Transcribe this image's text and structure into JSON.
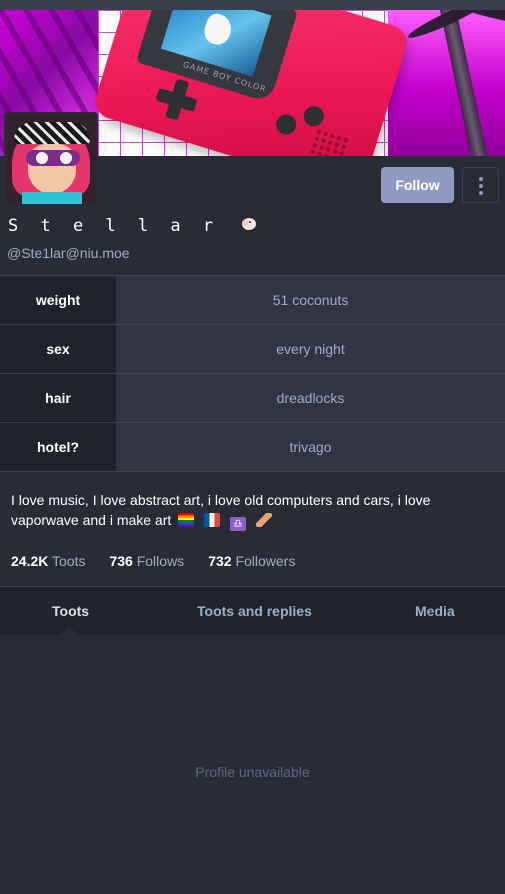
{
  "profile": {
    "display_name": "S t e l l a r",
    "handle": "@Ste1lar@niu.moe",
    "follow_label": "Follow",
    "more_icon": "vertical-ellipsis-icon",
    "avatar_icon": "inkling-girl-avatar"
  },
  "banner": {
    "gameboy_brand": "GAME BOY COLOR"
  },
  "fields": [
    {
      "name": "weight",
      "value": "51 coconuts"
    },
    {
      "name": "sex",
      "value": "every night"
    },
    {
      "name": "hair",
      "value": "dreadlocks"
    },
    {
      "name": "hotel?",
      "value": "trivago"
    }
  ],
  "bio": {
    "text": "I love music, I love abstract art, i love old computers and cars, i love vaporwave and i make art",
    "emojis": [
      "rainbow-flag",
      "france-flag",
      "libra",
      "bandage"
    ]
  },
  "counts": {
    "toots_value": "24.2K",
    "toots_label": "Toots",
    "follows_value": "736",
    "follows_label": "Follows",
    "followers_value": "732",
    "followers_label": "Followers"
  },
  "tabs": {
    "toots": "Toots",
    "replies": "Toots and replies",
    "media": "Media"
  },
  "empty_message": "Profile unavailable",
  "colors": {
    "background": "#282c37",
    "accent": "#8d9ac2",
    "secondary_text": "#9baec8",
    "muted_text": "#606984"
  }
}
